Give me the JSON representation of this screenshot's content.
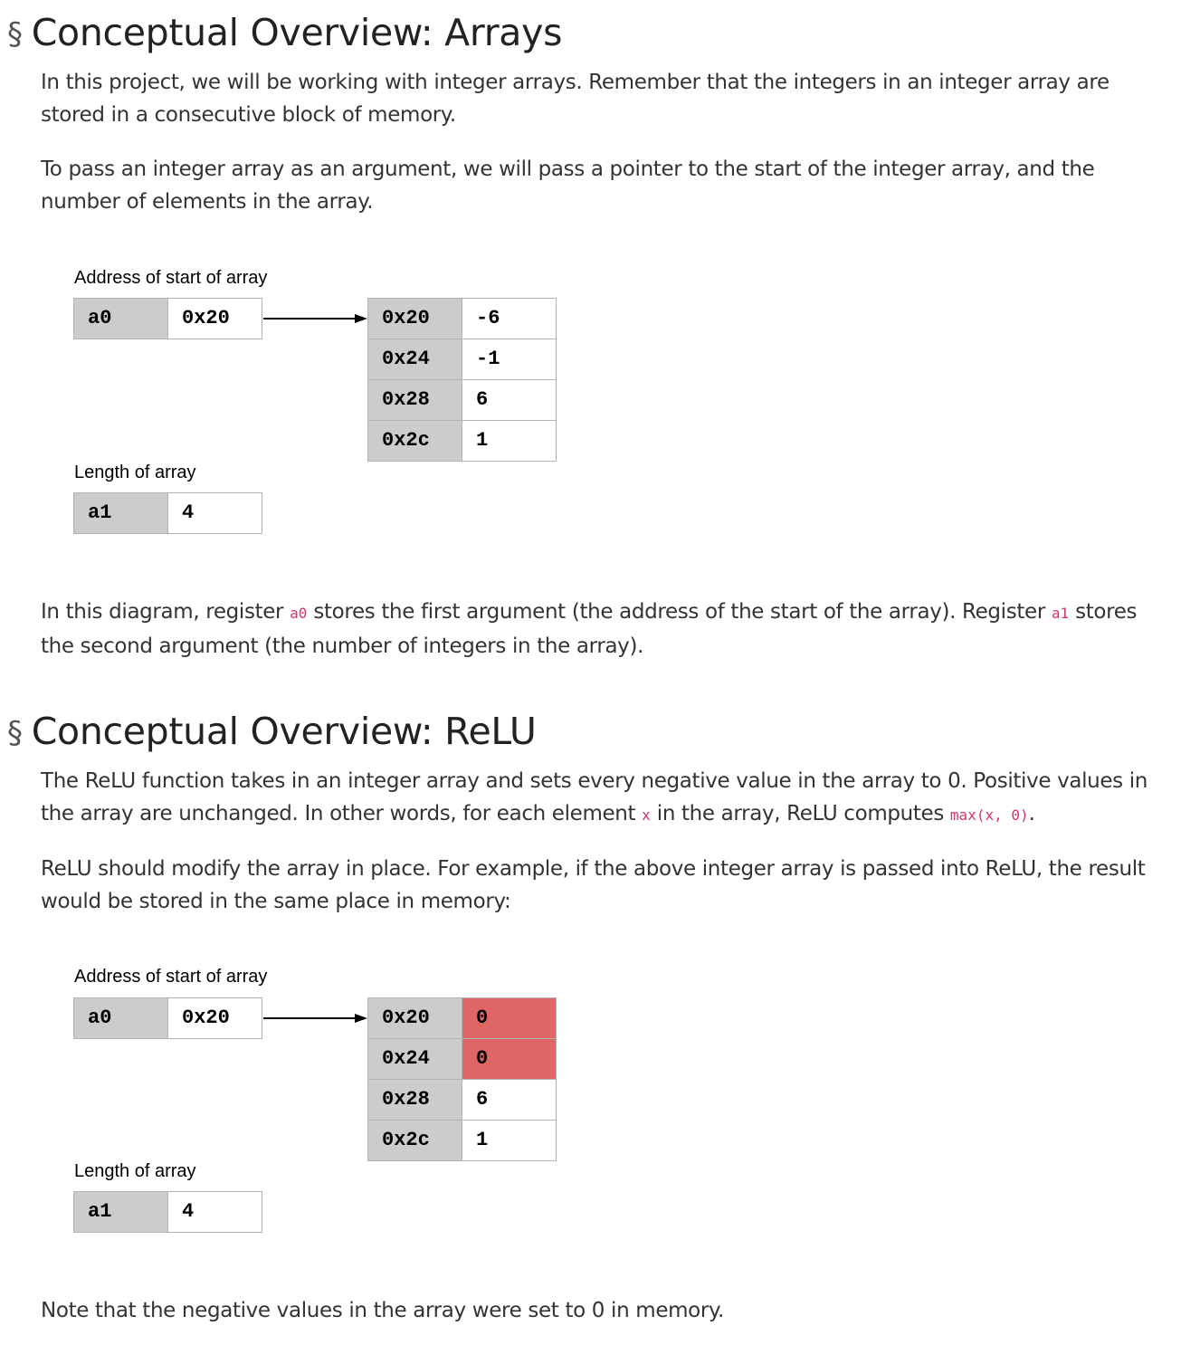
{
  "section1": {
    "symbol": "§",
    "heading": "Conceptual Overview: Arrays",
    "para1": "In this project, we will be working with integer arrays. Remember that the integers in an integer array are stored in a consecutive block of memory.",
    "para2": "To pass an integer array as an argument, we will pass a pointer to the start of the integer array, and the number of elements in the array.",
    "para3": {
      "t1": "In this diagram, register ",
      "c1": "a0",
      "t2": " stores the first argument (the address of the start of the array). Register ",
      "c2": "a1",
      "t3": " stores the second argument (the number of integers in the array)."
    }
  },
  "diagram1": {
    "address_label": "Address of start of array",
    "length_label": "Length of array",
    "a0": {
      "name": "a0",
      "value": "0x20"
    },
    "a1": {
      "name": "a1",
      "value": "4"
    },
    "memory": [
      {
        "address": "0x20",
        "value": "-6",
        "highlight": false
      },
      {
        "address": "0x24",
        "value": "-1",
        "highlight": false
      },
      {
        "address": "0x28",
        "value": "6",
        "highlight": false
      },
      {
        "address": "0x2c",
        "value": "1",
        "highlight": false
      }
    ]
  },
  "section2": {
    "symbol": "§",
    "heading": "Conceptual Overview: ReLU",
    "para1": {
      "t1": "The ReLU function takes in an integer array and sets every negative value in the array to 0. Positive values in the array are unchanged. In other words, for each element ",
      "c1": "x",
      "t2": " in the array, ReLU computes ",
      "c2": "max(x, 0)",
      "t3": "."
    },
    "para2": "ReLU should modify the array in place. For example, if the above integer array is passed into ReLU, the result would be stored in the same place in memory:",
    "para3": "Note that the negative values in the array were set to 0 in memory."
  },
  "diagram2": {
    "address_label": "Address of start of array",
    "length_label": "Length of array",
    "a0": {
      "name": "a0",
      "value": "0x20"
    },
    "a1": {
      "name": "a1",
      "value": "4"
    },
    "memory": [
      {
        "address": "0x20",
        "value": "0",
        "highlight": true
      },
      {
        "address": "0x24",
        "value": "0",
        "highlight": true
      },
      {
        "address": "0x28",
        "value": "6",
        "highlight": false
      },
      {
        "address": "0x2c",
        "value": "1",
        "highlight": false
      }
    ]
  },
  "colors": {
    "register_cell": "#cccccc",
    "highlight_cell": "#e06666",
    "inline_code": "#d6336c"
  }
}
